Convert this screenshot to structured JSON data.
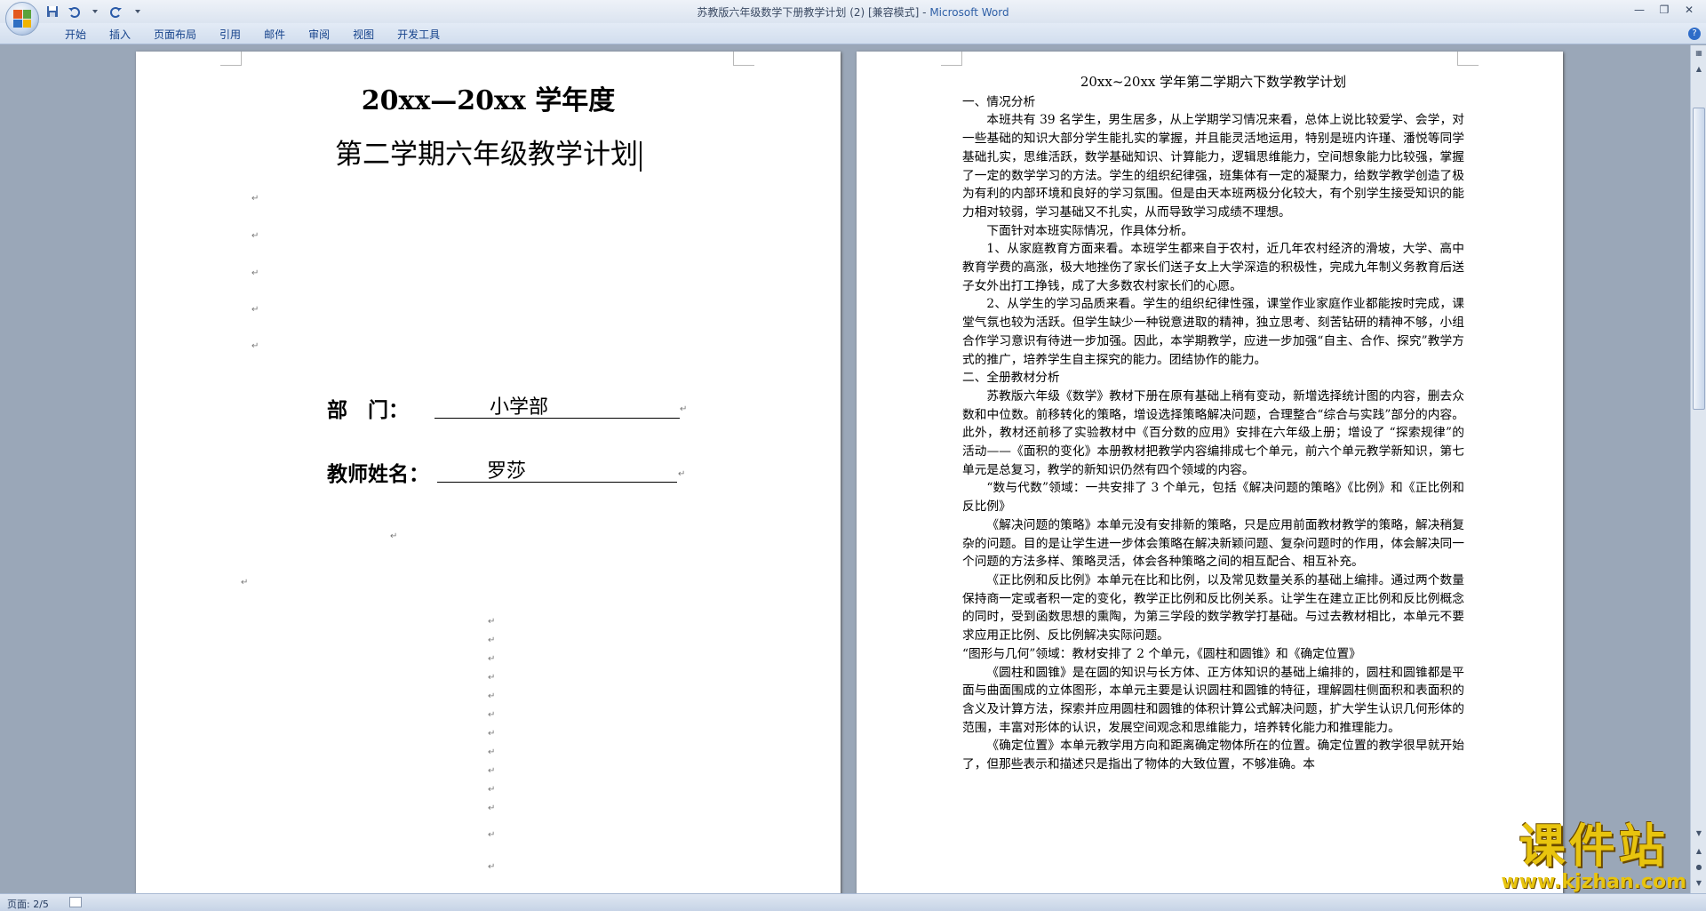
{
  "window": {
    "title": "苏教版六年级数学下册教学计划 (2) [兼容模式] - ",
    "app_name": "Microsoft Word"
  },
  "ribbon": {
    "tabs": [
      "开始",
      "插入",
      "页面布局",
      "引用",
      "邮件",
      "审阅",
      "视图",
      "开发工具"
    ]
  },
  "left_page": {
    "title_line1": "20xx—20xx 学年度",
    "title_line2": "第二学期六年级教学计划",
    "dept_label": "部　门：",
    "dept_value": "小学部",
    "teacher_label": "教师姓名：",
    "teacher_value": "罗莎"
  },
  "right_page": {
    "title": "20xx~20xx 学年第二学期六下数学教学计划",
    "paragraphs": [
      {
        "kind": "head",
        "text": "一、情况分析"
      },
      {
        "kind": "para",
        "text": "本班共有 39 名学生，男生居多，从上学期学习情况来看，总体上说比较爱学、会学，对一些基础的知识大部分学生能扎实的掌握，并且能灵活地运用，特别是班内许瑾、潘悦等同学基础扎实，思维活跃，数学基础知识、计算能力，逻辑思维能力，空间想象能力比较强，掌握了一定的数学学习的方法。学生的组织纪律强，班集体有一定的凝聚力，给数学教学创造了极为有利的内部环境和良好的学习氛围。但是由天本班两极分化较大，有个别学生接受知识的能力相对较弱，学习基础又不扎实，从而导致学习成绩不理想。"
      },
      {
        "kind": "para",
        "text": "下面针对本班实际情况，作具体分析。"
      },
      {
        "kind": "para",
        "text": "1、从家庭教育方面来看。本班学生都来自于农村，近几年农村经济的滑坡，大学、高中教育学费的高涨，极大地挫伤了家长们送子女上大学深造的积极性，完成九年制义务教育后送子女外出打工挣钱，成了大多数农村家长们的心愿。"
      },
      {
        "kind": "para",
        "text": "2、从学生的学习品质来看。学生的组织纪律性强，课堂作业家庭作业都能按时完成，课堂气氛也较为活跃。但学生缺少一种锐意进取的精神，独立思考、刻苦钻研的精神不够，小组合作学习意识有待进一步加强。因此，本学期教学，应进一步加强“自主、合作、探究”教学方式的推广，培养学生自主探究的能力。团结协作的能力。"
      },
      {
        "kind": "head",
        "text": "二、全册教材分析"
      },
      {
        "kind": "para",
        "text": "苏教版六年级《数学》教材下册在原有基础上稍有变动，新增选择统计图的内容，删去众数和中位数。前移转化的策略，增设选择策略解决问题，合理整合“综合与实践”部分的内容。此外，教材还前移了实验教材中《百分数的应用》安排在六年级上册；增设了 “探索规律”的活动——《面积的变化》本册教材把教学内容编排成七个单元，前六个单元教学新知识，第七单元是总复习，教学的新知识仍然有四个领域的内容。"
      },
      {
        "kind": "para",
        "text": "“数与代数”领域：一共安排了 3 个单元，包括《解决问题的策略》《比例》和《正比例和反比例》"
      },
      {
        "kind": "para",
        "text": "《解决问题的策略》本单元没有安排新的策略，只是应用前面教材教学的策略，解决稍复杂的问题。目的是让学生进一步体会策略在解决新颖问题、复杂问题时的作用，体会解决同一个问题的方法多样、策略灵活，体会各种策略之间的相互配合、相互补充。"
      },
      {
        "kind": "para",
        "text": "《正比例和反比例》本单元在比和比例，以及常见数量关系的基础上编排。通过两个数量保持商一定或者积一定的变化，教学正比例和反比例关系。让学生在建立正比例和反比例概念的同时，受到函数思想的熏陶，为第三学段的数学教学打基础。与过去教材相比，本单元不要求应用正比例、反比例解决实际问题。"
      },
      {
        "kind": "head",
        "text": "“图形与几何”领域：教材安排了 2 个单元，《圆柱和圆锥》和《确定位置》"
      },
      {
        "kind": "para",
        "text": "《圆柱和圆锥》是在圆的知识与长方体、正方体知识的基础上编排的，圆柱和圆锥都是平面与曲面围成的立体图形，本单元主要是认识圆柱和圆锥的特征，理解圆柱侧面积和表面积的含义及计算方法，探索并应用圆柱和圆锥的体积计算公式解决问题，扩大学生认识几何形体的范围，丰富对形体的认识，发展空间观念和思维能力，培养转化能力和推理能力。"
      },
      {
        "kind": "para",
        "text": "《确定位置》本单元教学用方向和距离确定物体所在的位置。确定位置的教学很早就开始了，但那些表示和描述只是指出了物体的大致位置，不够准确。本"
      }
    ]
  },
  "status": {
    "page": "页面: 2/5"
  },
  "watermark": {
    "name": "课件站",
    "url": "www.kjzhan.com"
  }
}
